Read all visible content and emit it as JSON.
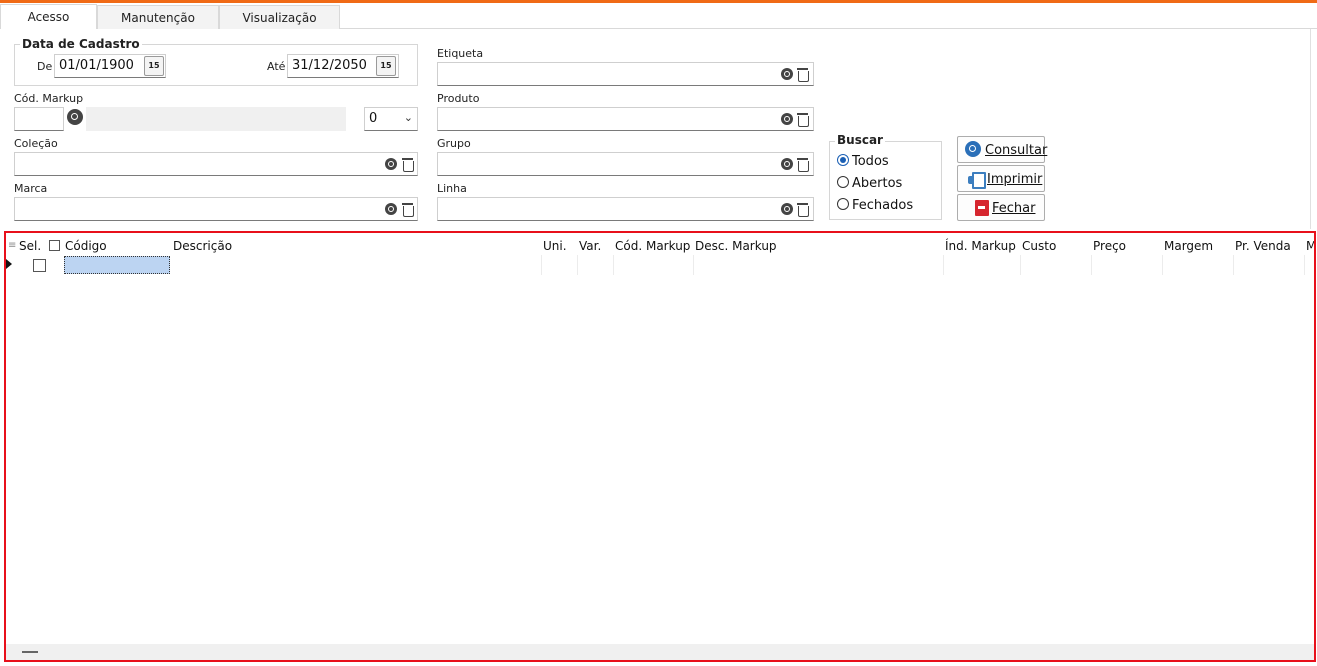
{
  "tabs": [
    {
      "label": "Acesso",
      "active": true
    },
    {
      "label": "Manutenção",
      "active": false
    },
    {
      "label": "Visualização",
      "active": false
    }
  ],
  "data_cadastro": {
    "title": "Data de Cadastro",
    "de_label": "De",
    "de_value": "01/01/1900",
    "ate_label": "Até",
    "ate_value": "31/12/2050",
    "calendar_glyph": "15"
  },
  "cod_markup": {
    "label": "Cód. Markup",
    "value": "",
    "description": "",
    "select_value": "0"
  },
  "colecao": {
    "label": "Coleção",
    "value": ""
  },
  "marca": {
    "label": "Marca",
    "value": ""
  },
  "etiqueta": {
    "label": "Etiqueta",
    "value": ""
  },
  "produto": {
    "label": "Produto",
    "value": ""
  },
  "grupo": {
    "label": "Grupo",
    "value": ""
  },
  "linha": {
    "label": "Linha",
    "value": ""
  },
  "buscar": {
    "title": "Buscar",
    "options": [
      {
        "label": "Todos",
        "selected": true
      },
      {
        "label": "Abertos",
        "selected": false
      },
      {
        "label": "Fechados",
        "selected": false
      }
    ]
  },
  "buttons": {
    "consultar": "Consultar",
    "imprimir": "Imprimir",
    "fechar": "Fechar"
  },
  "grid": {
    "columns": [
      "Sel.",
      "Código",
      "Descrição",
      "Uni.",
      "Var.",
      "Cód. Markup",
      "Desc. Markup",
      "Índ. Markup",
      "Custo",
      "Preço",
      "Margem",
      "Pr. Venda",
      "M"
    ],
    "rows": [
      {
        "sel": false,
        "codigo": ""
      }
    ]
  },
  "colors": {
    "accent": "#f06a16",
    "highlight_border": "#e8101b",
    "selection": "#bcd4f2"
  }
}
